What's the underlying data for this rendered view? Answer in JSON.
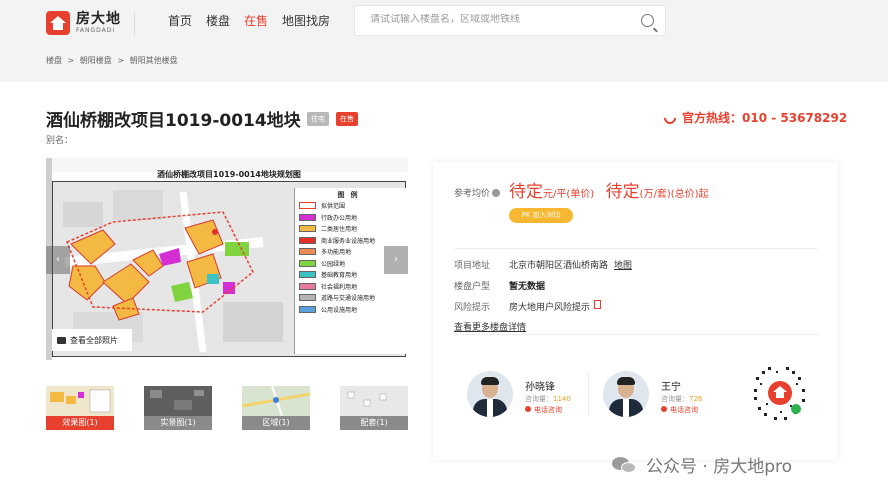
{
  "header": {
    "logo_cn": "房大地",
    "logo_en": "FANGDADI",
    "nav": [
      {
        "label": "首页",
        "active": false
      },
      {
        "label": "楼盘",
        "active": false
      },
      {
        "label": "在售",
        "active": true
      },
      {
        "label": "地图找房",
        "active": false
      }
    ],
    "search_placeholder": "请试试输入楼盘名，区域或地铁线"
  },
  "breadcrumb": [
    "楼盘",
    ">",
    "朝阳楼盘",
    ">",
    "朝阳其他楼盘"
  ],
  "project": {
    "title": "酒仙桥棚改项目1019-0014地块",
    "type_tag": "住宅",
    "status_tag": "在售",
    "alias": "别名：",
    "hotline": "官方热线：010 - 53678292"
  },
  "gallery": {
    "map_title": "酒仙桥棚改项目1019-0014地块规划图",
    "legend_title": "图例",
    "legend": [
      {
        "label": "拟供范围",
        "color": "#ffffff",
        "border": "#e8402f"
      },
      {
        "label": "行政办公用地",
        "color": "#d42fd4"
      },
      {
        "label": "二类居住用地",
        "color": "#f4b942"
      },
      {
        "label": "商业服务业设施用地",
        "color": "#e0302a"
      },
      {
        "label": "多功能用地",
        "color": "#f08a55"
      },
      {
        "label": "公园绿地",
        "color": "#7fd440"
      },
      {
        "label": "基础教育用地",
        "color": "#3cc2c2"
      },
      {
        "label": "社会福利用地",
        "color": "#e87aa0"
      },
      {
        "label": "道路与交通设施用地",
        "color": "#b5b5b5"
      },
      {
        "label": "公用设施用地",
        "color": "#5aa0e0"
      }
    ],
    "all_photos": "查看全部照片",
    "prev_arrow": "‹",
    "next_arrow": "›",
    "thumbs": [
      {
        "label": "效果图(1)",
        "active": true
      },
      {
        "label": "实景图(1)",
        "active": false
      },
      {
        "label": "区域(1)",
        "active": false
      },
      {
        "label": "配套(1)",
        "active": false
      }
    ]
  },
  "price": {
    "label": "参考均价",
    "value1": "待定",
    "unit1": "元/平(单价)",
    "value2": "待定",
    "unit2": "(万/套)(总价)起",
    "compare": "PK 加入对比"
  },
  "info": {
    "address_key": "项目地址",
    "address_val": "北京市朝阳区酒仙桥南路",
    "map_link": "地图",
    "layout_key": "楼盘户型",
    "layout_val": "暂无数据",
    "risk_key": "风险提示",
    "risk_val": "房大地用户风险提示",
    "more": "查看更多楼盘详情"
  },
  "agents": [
    {
      "name": "孙晓锋",
      "count_label": "咨询量：",
      "count": "1140",
      "call": "电话咨询"
    },
    {
      "name": "王宁",
      "count_label": "咨询量：",
      "count": "726",
      "call": "电话咨询"
    }
  ],
  "watermark": "公众号 · 房大地pro"
}
